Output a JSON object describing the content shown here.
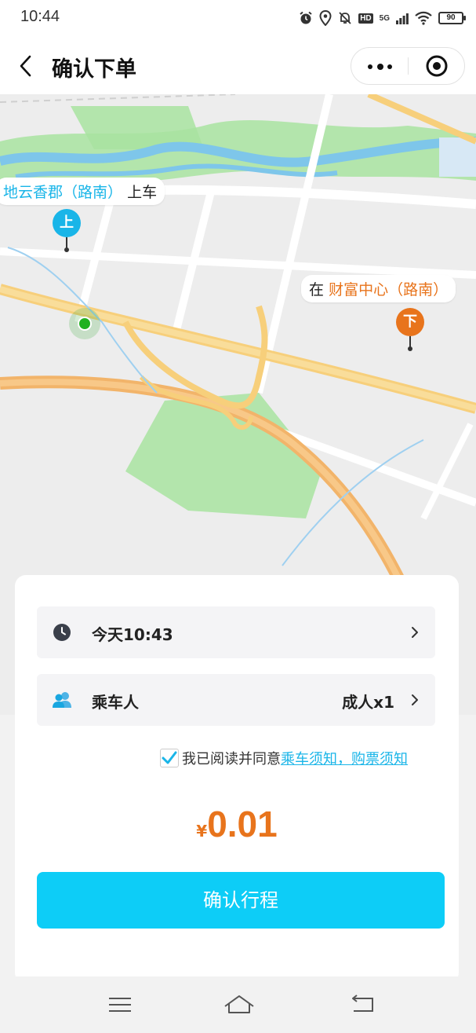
{
  "status_bar": {
    "time": "10:44",
    "network": "5G",
    "hd": "HD",
    "battery": "90",
    "icons": [
      "alarm-icon",
      "location-icon",
      "mute-icon",
      "hd-icon",
      "signal-icon",
      "wifi-icon",
      "battery-icon"
    ]
  },
  "nav": {
    "title": "确认下单",
    "back_icon": "chevron-left-icon",
    "more_icon": "more-dots-icon",
    "close_icon": "target-close-icon"
  },
  "map": {
    "pickup_place": "地云香郡（路南）",
    "pickup_suffix": "上车",
    "pickup_pin": "上",
    "drop_prefix": "在",
    "drop_place": "财富中心（路南）",
    "drop_pin": "下",
    "colors": {
      "pickup": "#19b5e8",
      "drop": "#e8741c",
      "current": "#21b121"
    }
  },
  "order": {
    "time_label": "今天10:43",
    "passenger_label": "乘车人",
    "passenger_value": "成人x1",
    "agree_text": "我已阅读并同意",
    "agree_link": "乘车须知，购票须知",
    "price_symbol": "¥",
    "price": "0.01",
    "confirm_label": "确认行程"
  },
  "colors": {
    "accent": "#0dcdf7",
    "price": "#e8741c",
    "link": "#19b5e8"
  }
}
